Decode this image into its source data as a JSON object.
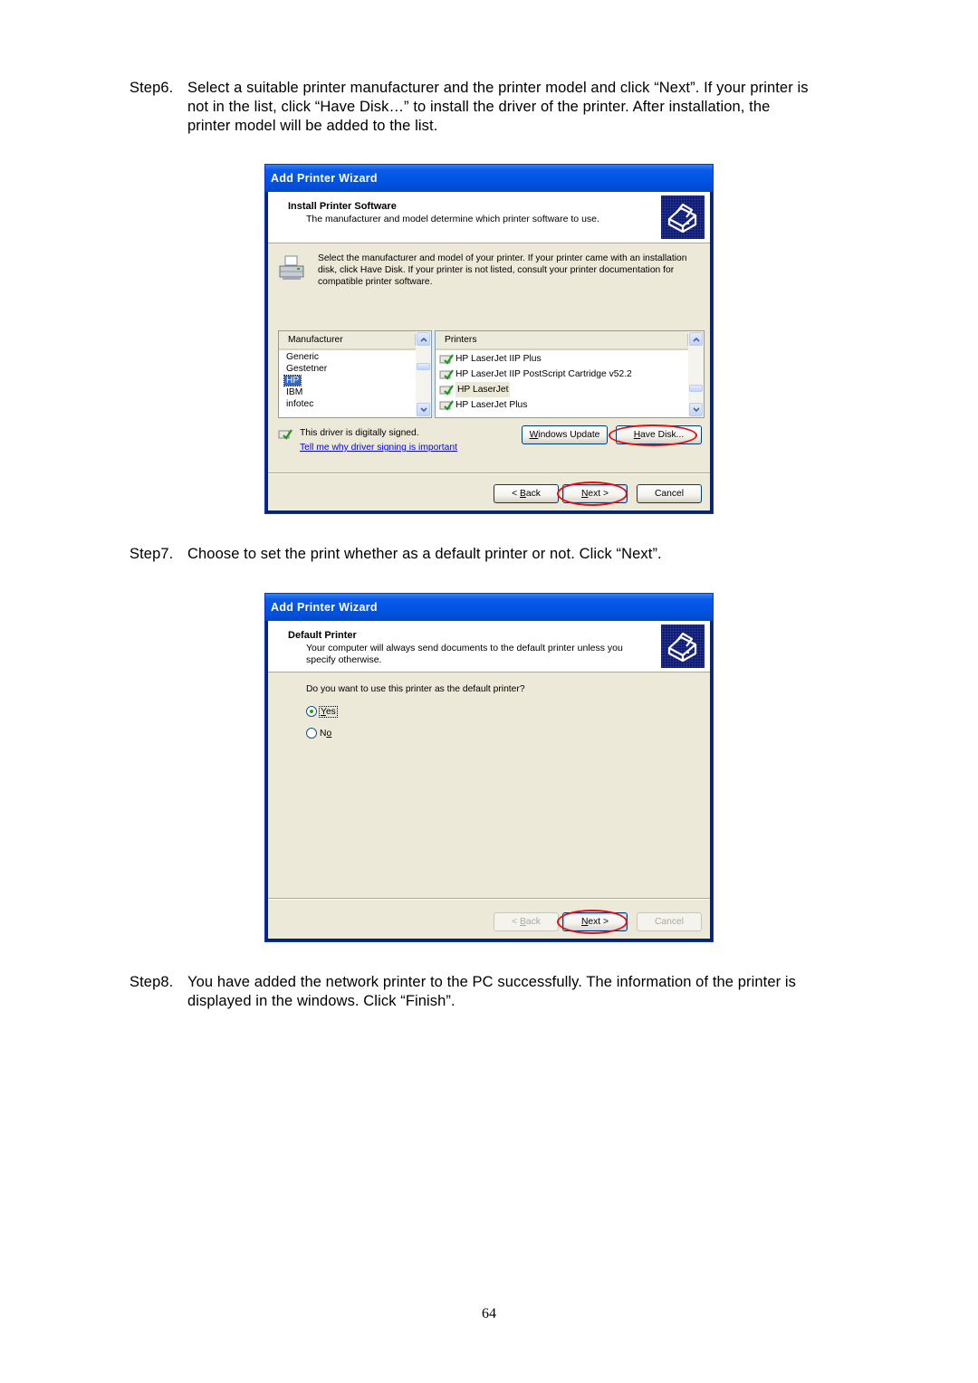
{
  "steps": [
    {
      "number": "Step6.",
      "lines": [
        "Select a suitable printer manufacturer and the printer model and click “Next”. If your printer is",
        "not in the list, click “Have Disk…” to install the driver of the printer. After installation, the",
        "printer model will be added to the list."
      ]
    },
    {
      "number": "Step7.",
      "lines": [
        "Choose to set the print whether as a default printer or not. Click “Next”."
      ]
    },
    {
      "number": "Step8.",
      "lines": [
        "You have added the network printer to the PC successfully. The information of the printer is",
        "displayed in the windows. Click “Finish”."
      ]
    }
  ],
  "wizard1": {
    "window_title": "Add Printer Wizard",
    "header_title": "Install Printer Software",
    "header_subtitle": "The manufacturer and model determine which printer software to use.",
    "header_icon": "printer-icon",
    "intro": "Select the manufacturer and model of your printer. If your printer came with an installation disk, click Have Disk. If your printer is not listed, consult your printer documentation for compatible printer software.",
    "manufacturer_header": "Manufacturer",
    "manufacturers": [
      "Generic",
      "Gestetner",
      "HP",
      "IBM",
      "infotec"
    ],
    "selected_manufacturer": "HP",
    "printers_header": "Printers",
    "printers": [
      "HP LaserJet IIP Plus",
      "HP LaserJet IIP PostScript Cartridge v52.2",
      "HP LaserJet",
      "HP LaserJet Plus"
    ],
    "selected_printer": "HP LaserJet",
    "signed_text": "This driver is digitally signed.",
    "signed_link": "Tell me why driver signing is important",
    "windows_update_button": {
      "accel": "W",
      "rest": "indows Update"
    },
    "have_disk_button": {
      "accel": "H",
      "rest": "ave Disk..."
    },
    "back_button": {
      "pre": "< ",
      "accel": "B",
      "rest": "ack"
    },
    "next_button": {
      "accel": "N",
      "rest": "ext >"
    },
    "cancel_button": "Cancel",
    "highlight_color": "#e01010"
  },
  "wizard2": {
    "window_title": "Add Printer Wizard",
    "header_title": "Default Printer",
    "header_subtitle": "Your computer will always send documents to the default printer unless you specify otherwise.",
    "question": "Do you want to use this printer as the default printer?",
    "options": [
      {
        "accel": "Y",
        "rest": "es",
        "selected": true
      },
      {
        "pre": "N",
        "accel": "o",
        "selected": false
      }
    ],
    "back_button": {
      "pre": "< ",
      "accel": "B",
      "rest": "ack",
      "disabled": true
    },
    "next_button": {
      "accel": "N",
      "rest": "ext >"
    },
    "cancel_button": "Cancel"
  },
  "page_number": "64"
}
